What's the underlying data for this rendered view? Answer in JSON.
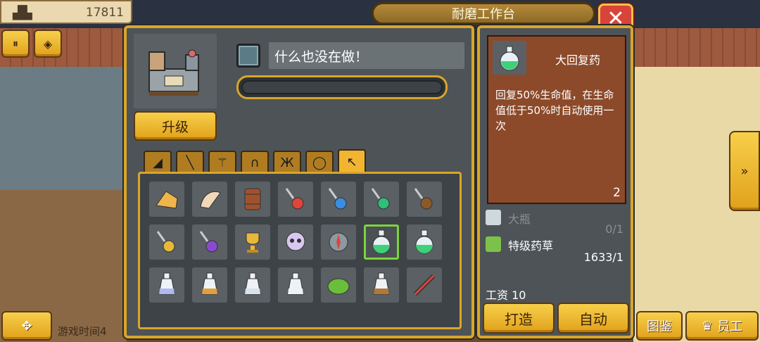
{
  "hud": {
    "gold_amount": "17811",
    "game_time_label": "游戏时间4"
  },
  "window": {
    "title": "耐磨工作台",
    "close_glyph": "✕"
  },
  "station": {
    "upgrade_label": "升级",
    "status_text": "什么也没在做！",
    "progress": 0
  },
  "tabs": [
    {
      "icon": "shield-icon",
      "glyph": "◢"
    },
    {
      "icon": "sword-icon",
      "glyph": "╲"
    },
    {
      "icon": "wand-icon",
      "glyph": "⚚"
    },
    {
      "icon": "helmet-icon",
      "glyph": "∩"
    },
    {
      "icon": "armor-icon",
      "glyph": "Ж"
    },
    {
      "icon": "ring-icon",
      "glyph": "◯"
    },
    {
      "icon": "pickaxe-icon",
      "glyph": "↖"
    }
  ],
  "active_tab": 6,
  "selected_item": {
    "name": "大回复药",
    "description": "回复50%生命值，在生命值低于50%时自动使用一次",
    "count": "2"
  },
  "materials": [
    {
      "name": "大瓶",
      "count": "0/1",
      "sufficient": false
    },
    {
      "name": "特级药草",
      "count": "1633/1",
      "sufficient": true
    }
  ],
  "wage": "工资 10",
  "buttons": {
    "craft_label": "打造",
    "auto_label": "自动",
    "encyclopedia_label": "图鉴",
    "staff_label": "员工"
  },
  "colors": {
    "gold": "#e1a11b",
    "panel": "#4e5357",
    "desc_bg": "#8c4a2a",
    "selected_border": "#7bd43a"
  }
}
